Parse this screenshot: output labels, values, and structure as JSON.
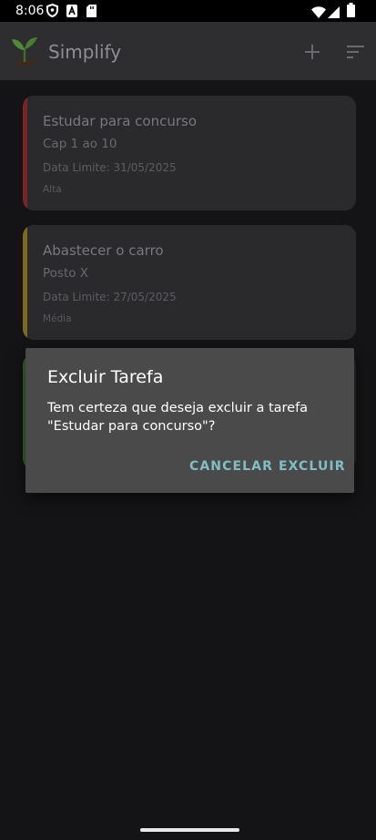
{
  "status_bar": {
    "time": "8:06",
    "icons": [
      "shield-icon",
      "a-notification-icon",
      "sd-card-icon",
      "wifi-icon",
      "signal-icon",
      "battery-icon"
    ]
  },
  "app_bar": {
    "title": "Simplify",
    "logo": "sprout-logo-icon",
    "actions": [
      "add-icon",
      "sort-icon"
    ]
  },
  "tasks": [
    {
      "title": "Estudar para concurso",
      "description": "Cap 1 ao 10",
      "deadline": "Data Limite: 31/05/2025",
      "priority": "Alta",
      "accent_color": "#7a2523"
    },
    {
      "title": "Abastecer o carro",
      "description": "Posto X",
      "deadline": "Data Limite: 27/05/2025",
      "priority": "Média",
      "accent_color": "#7d6a1d"
    },
    {
      "accent_color": "#2f6b26"
    }
  ],
  "dialog": {
    "title": "Excluir Tarefa",
    "message": "Tem certeza que deseja excluir a tarefa\n\"Estudar para concurso\"?",
    "cancel_label": "CANCELAR",
    "confirm_label": "EXCLUIR",
    "button_color": "#7fbfc3"
  }
}
